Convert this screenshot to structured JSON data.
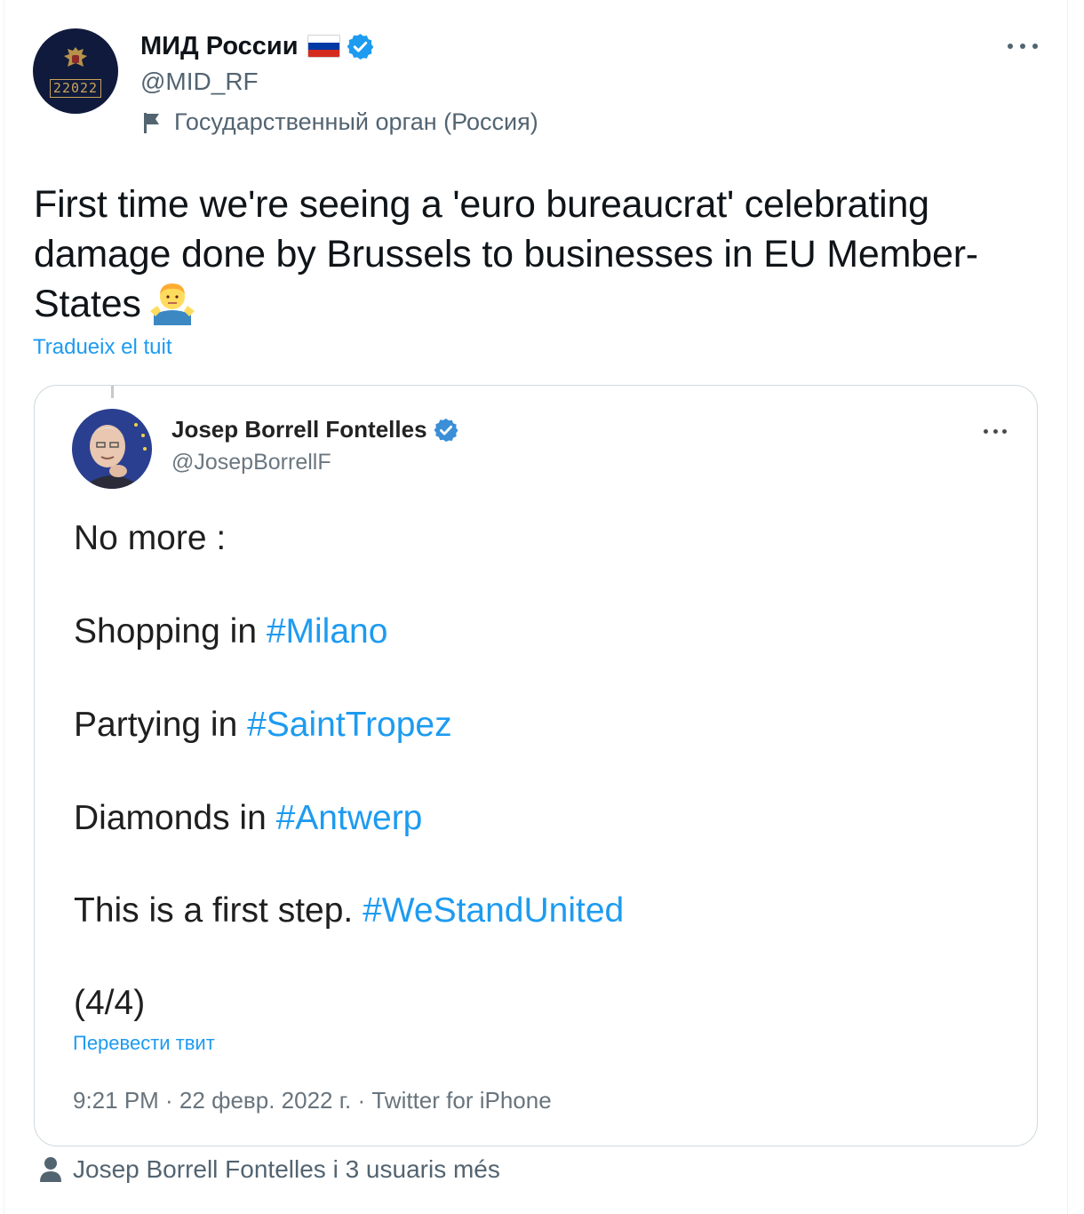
{
  "tweet": {
    "author": {
      "display_name": "МИД России",
      "handle": "@MID_RF",
      "avatar_text": "22022",
      "label": "Государственный орган (Россия)",
      "flag_colors": [
        "#ffffff",
        "#0039a6",
        "#d52b1e"
      ]
    },
    "text": "First time we're seeing a 'euro bureaucrat' celebrating damage done by Brussels to businesses in EU Member-States",
    "emoji": "man-shrugging",
    "translate_link": "Tradueix el tuit"
  },
  "quoted": {
    "author": {
      "display_name": "Josep Borrell Fontelles",
      "handle": "@JosepBorrellF"
    },
    "lines": [
      {
        "text": "No more :",
        "hashtag": ""
      },
      {
        "text": "Shopping in ",
        "hashtag": "#Milano"
      },
      {
        "text": "Partying in ",
        "hashtag": "#SaintTropez"
      },
      {
        "text": "Diamonds in ",
        "hashtag": "#Antwerp"
      },
      {
        "text": "This is a first step. ",
        "hashtag": "#WeStandUnited"
      },
      {
        "text": "(4/4)",
        "hashtag": ""
      }
    ],
    "translate_link": "Перевести твит",
    "meta": "9:21 PM · 22 февр. 2022 г. · Twitter for iPhone"
  },
  "footer": {
    "tagged": "Josep Borrell Fontelles i 3 usuaris més"
  },
  "colors": {
    "link": "#1d9bf0",
    "secondary_text": "#536471",
    "border": "#cfd9de"
  }
}
